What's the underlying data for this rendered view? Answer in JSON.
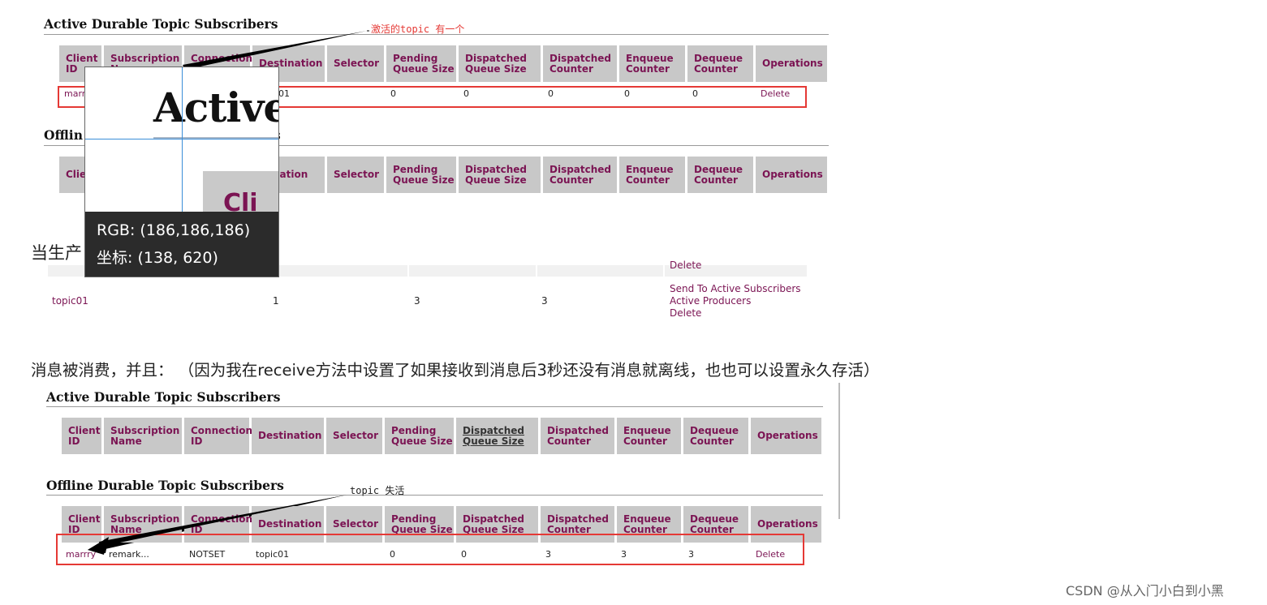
{
  "top": {
    "active_title": "Active Durable Topic Subscribers",
    "annotation": "激活的topic 有一个",
    "headers": [
      "Client ID",
      "Subscription Name",
      "Connection ID",
      "Destination",
      "Selector",
      "Pending Queue Size",
      "Dispatched Queue Size",
      "Dispatched Counter",
      "Enqueue Counter",
      "Dequeue Counter",
      "Operations"
    ],
    "row": {
      "client": "marr",
      "destination": "01",
      "pending": "0",
      "dispatched_qs": "0",
      "dispatched_counter": "0",
      "enqueue": "0",
      "dequeue": "0",
      "operation": "Delete"
    },
    "offline_title": "Offlin",
    "offline_title_tail": "s",
    "offline_headers": [
      "Clie ID",
      "stination",
      "Selector",
      "Pending Queue Size",
      "Dispatched Queue Size",
      "Dispatched Counter",
      "Enqueue Counter",
      "Dequeue Counter",
      "Operations"
    ]
  },
  "magnifier": {
    "zoom_text": "Active",
    "zoom_text2": "Cli",
    "rgb_label": "RGB: (186,186,186)",
    "coord_label": "坐标: (138, 620)"
  },
  "middle": {
    "prose_visible": "当生产",
    "delete_top": "Delete",
    "topic_name": "topic01",
    "col1": "1",
    "col2": "3",
    "col3": "3",
    "actions": [
      "Send To Active Subscribers",
      "Active Producers",
      "Delete"
    ]
  },
  "consumed_text": "消息被消费，并且：  （因为我在receive方法中设置了如果接收到消息后3秒还没有消息就离线，也也可以设置永久存活）",
  "bottom": {
    "active_title": "Active Durable Topic Subscribers",
    "headers": [
      "Client ID",
      "Subscription Name",
      "Connection ID",
      "Destination",
      "Selector",
      "Pending Queue Size",
      "Dispatched Queue Size",
      "Dispatched Counter",
      "Enqueue Counter",
      "Dequeue Counter",
      "Operations"
    ],
    "offline_title": "Offline Durable Topic Subscribers",
    "annotation": "topic 失活",
    "offline_headers": [
      "Client ID",
      "Subscription Name",
      "Connection ID",
      "Destination",
      "Selector",
      "Pending Queue Size",
      "Dispatched Queue Size",
      "Dispatched Counter",
      "Enqueue Counter",
      "Dequeue Counter",
      "Operations"
    ],
    "row": {
      "client": "marrry",
      "subscription": "remark...",
      "connection": "NOTSET",
      "destination": "topic01",
      "pending": "0",
      "dispatched_qs": "0",
      "dispatched_counter": "3",
      "enqueue": "3",
      "dequeue": "3",
      "operation": "Delete"
    }
  },
  "watermark": "CSDN @从入门小白到小黑",
  "colors": {
    "header_bg": "#c8c8c8",
    "header_text": "#7b1453",
    "highlight": "#e53935",
    "annotation": "#e53935"
  }
}
